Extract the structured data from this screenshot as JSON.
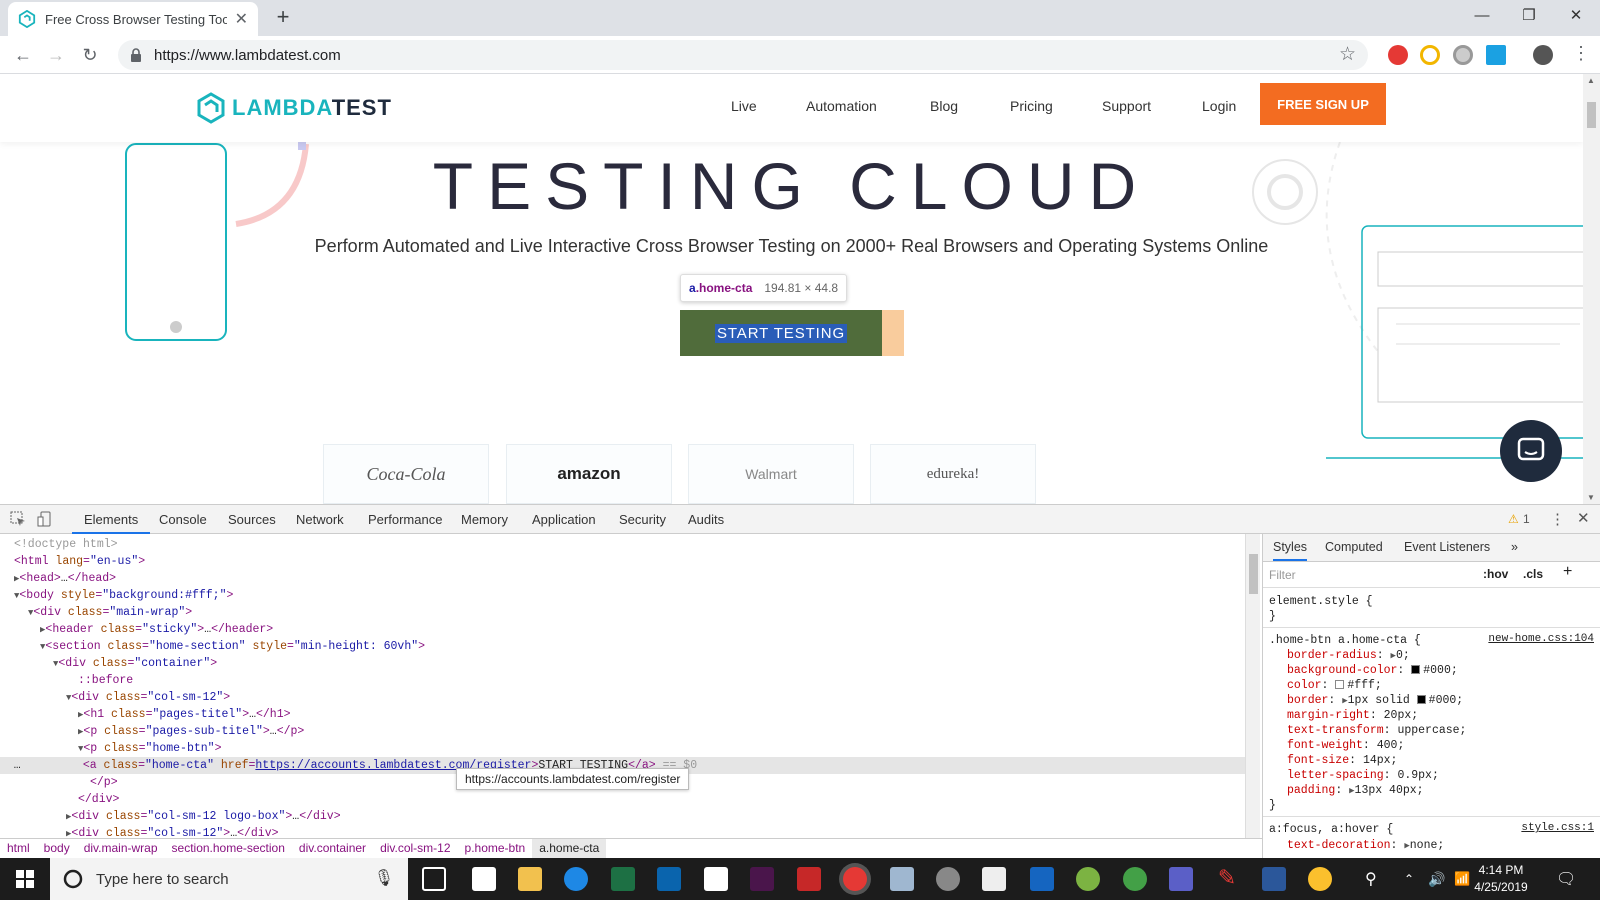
{
  "browser": {
    "tab_title": "Free Cross Browser Testing Tool",
    "url": "https://www.lambdatest.com"
  },
  "site": {
    "logo_part1": "LAMBDA",
    "logo_part2": "TEST",
    "nav": [
      "Live",
      "Automation",
      "Blog",
      "Pricing",
      "Support",
      "Login"
    ],
    "signup": "FREE SIGN UP",
    "hero_title": "TESTING CLOUD",
    "hero_subtitle": "Perform Automated and Live Interactive Cross Browser Testing on 2000+ Real Browsers and Operating Systems Online",
    "cta": "START TESTING",
    "client_logos": [
      "Coca-Cola",
      "amazon",
      "Walmart",
      "edureka!"
    ]
  },
  "inspect_tooltip": {
    "selector_tag": "a",
    "selector_class": ".home-cta",
    "dimensions": "194.81 × 44.8"
  },
  "devtools": {
    "tabs": [
      "Elements",
      "Console",
      "Sources",
      "Network",
      "Performance",
      "Memory",
      "Application",
      "Security",
      "Audits"
    ],
    "active_tab": "Elements",
    "warning_count": "1",
    "link_tooltip": "https://accounts.lambdatest.com/register",
    "breadcrumbs": [
      "html",
      "body",
      "div.main-wrap",
      "section.home-section",
      "div.container",
      "div.col-sm-12",
      "p.home-btn",
      "a.home-cta"
    ],
    "styles_tabs": [
      "Styles",
      "Computed",
      "Event Listeners"
    ],
    "filter_placeholder": "Filter",
    "hov": ":hov",
    "cls": ".cls",
    "element_style": "element.style {",
    "rule_selector": ".home-btn a.home-cta {",
    "rule_source": "new-home.css:104",
    "rule_props": [
      {
        "name": "border-radius",
        "value": "0;",
        "arrow": true
      },
      {
        "name": "background-color",
        "value": "#000;",
        "swatch": "#000000"
      },
      {
        "name": "color",
        "value": "#fff;",
        "swatch": "#ffffff"
      },
      {
        "name": "border",
        "value": "1px solid ",
        "arrow": true,
        "swatch": "#000000",
        "after": "#000;"
      },
      {
        "name": "margin-right",
        "value": "20px;"
      },
      {
        "name": "text-transform",
        "value": "uppercase;"
      },
      {
        "name": "font-weight",
        "value": "400;"
      },
      {
        "name": "font-size",
        "value": "14px;"
      },
      {
        "name": "letter-spacing",
        "value": "0.9px;"
      },
      {
        "name": "padding",
        "value": "13px 40px;",
        "arrow": true
      }
    ],
    "rule2_selector": "a:focus, a:hover {",
    "rule2_source": "style.css:1",
    "rule2_prop": {
      "name": "text-decoration",
      "value": "none;"
    }
  },
  "taskbar": {
    "search_placeholder": "Type here to search",
    "time": "4:14 PM",
    "date": "4/25/2019"
  },
  "colors": {
    "brand_teal": "#19b4bd",
    "brand_orange": "#f36c21",
    "devtools_accent": "#1a73e8"
  }
}
